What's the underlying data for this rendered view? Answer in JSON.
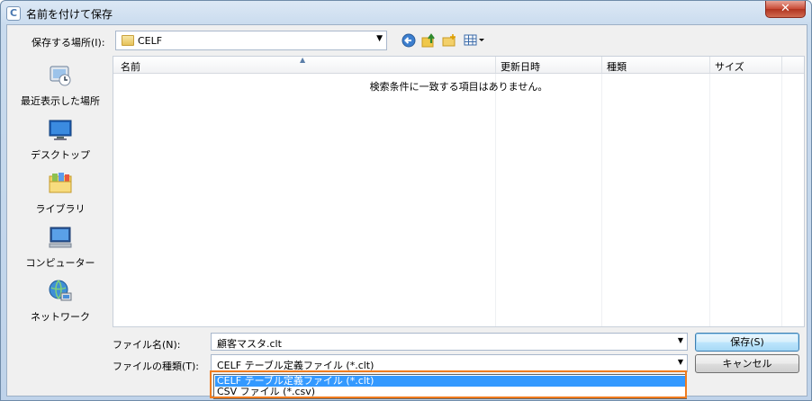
{
  "window": {
    "title": "名前を付けて保存",
    "close_glyph": "✕",
    "app_letter": "C"
  },
  "toolbar": {
    "location_label": "保存する場所(I):",
    "location_value": "CELF",
    "icons": [
      "back-icon",
      "up-folder-icon",
      "new-folder-icon",
      "view-menu-icon"
    ]
  },
  "places": [
    {
      "label": "最近表示した場所",
      "icon": "recent-places-icon"
    },
    {
      "label": "デスクトップ",
      "icon": "desktop-icon"
    },
    {
      "label": "ライブラリ",
      "icon": "libraries-icon"
    },
    {
      "label": "コンピューター",
      "icon": "computer-icon"
    },
    {
      "label": "ネットワーク",
      "icon": "network-icon"
    }
  ],
  "file_list": {
    "columns": [
      "名前",
      "更新日時",
      "種類",
      "サイズ"
    ],
    "empty_message": "検索条件に一致する項目はありません。"
  },
  "form": {
    "filename_label": "ファイル名(N):",
    "filename_value": "顧客マスタ.clt",
    "filetype_label": "ファイルの種類(T):",
    "filetype_value": "CELF テーブル定義ファイル (*.clt)"
  },
  "buttons": {
    "save": "保存(S)",
    "cancel": "キャンセル"
  },
  "dropdown": {
    "options": [
      "CELF テーブル定義ファイル (*.clt)",
      "CSV ファイル (*.csv)"
    ],
    "selected_index": 0
  },
  "colors": {
    "highlight": "#f07c1e",
    "selection": "#3399ff"
  }
}
